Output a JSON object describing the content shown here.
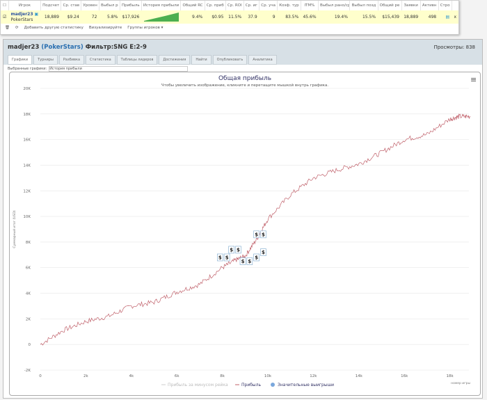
{
  "stats": {
    "headers": [
      "Игрок",
      "Подсчет",
      "Ср. став",
      "Уровен",
      "Выбыл р",
      "Прибыль",
      "История прибыли",
      "Общий RC",
      "Ср. приб",
      "Ср. ROI",
      "Ср. иг",
      "Ср. уча",
      "Коэф. тур",
      "ITM%",
      "Выбыл рано/ср",
      "Выбыл позд",
      "Общий ре",
      "Заявки",
      "Активн",
      "Стро"
    ],
    "row": {
      "player": "madjer23",
      "site": "PokerStars",
      "values": [
        "18,889",
        "$9.24",
        "72",
        "5.8%",
        "$17,926",
        "",
        "9.4%",
        "$0.95",
        "11.5%",
        "37.9",
        "9",
        "83.5%",
        "45.6%",
        "19.4%",
        "15.5%",
        "$15,439",
        "18,889",
        "498"
      ],
      "x": "x"
    },
    "tools": {
      "add": "Добавить другую статистику",
      "viz": "Визуализируйте",
      "groups": "Группы игроков ▾"
    }
  },
  "panel": {
    "player": "madjer23",
    "site": "(PokerStars)",
    "filter": "Фильтр:SNG E:2-9",
    "views": "Просмотры: 838",
    "tabs": [
      "Графики",
      "Турниры",
      "Разбивка",
      "Статистика",
      "Таблицы лидеров",
      "Достижения",
      "Найти",
      "Опубликовать",
      "Аналитика"
    ],
    "selected_label": "Выбранные графики:",
    "selected_value": "История прибыли"
  },
  "chart_data": {
    "type": "line",
    "title": "Общая прибыль",
    "subtitle": "Чтобы увеличить изображение, кликните и перетащите мышкой внутрь графика.",
    "xlabel": "номер игры",
    "ylabel": "Суммарный итог (USD)",
    "xlim": [
      0,
      19000
    ],
    "ylim": [
      -2000,
      20000
    ],
    "xticks": [
      "0",
      "2k",
      "4k",
      "6k",
      "8k",
      "10k",
      "12k",
      "14k",
      "16k",
      "18k"
    ],
    "yticks": [
      "-2K",
      "0",
      "2K",
      "4K",
      "6K",
      "8K",
      "10K",
      "12K",
      "14K",
      "16K",
      "18K",
      "20K"
    ],
    "legend": [
      "Прибыль за минусом рейка",
      "Прибыль",
      "Значительные выигрыши"
    ],
    "series": [
      {
        "name": "Прибыль",
        "color": "#c0606a",
        "x": [
          0,
          1000,
          2000,
          3000,
          4000,
          5000,
          6000,
          7000,
          8000,
          8600,
          9000,
          9500,
          10000,
          11000,
          12000,
          13000,
          14000,
          15000,
          16000,
          17000,
          18000,
          18400,
          18900
        ],
        "y": [
          0,
          1100,
          1800,
          2200,
          3000,
          3300,
          4100,
          4700,
          6000,
          6600,
          6900,
          8200,
          9800,
          11700,
          13000,
          13600,
          14100,
          15000,
          16000,
          16400,
          17600,
          17800,
          17800
        ]
      }
    ],
    "big_wins": {
      "x": [
        7900,
        8200,
        8400,
        8700,
        8900,
        9200,
        9500,
        9800,
        9500,
        9800
      ],
      "y": [
        6800,
        6800,
        7400,
        7400,
        6500,
        6500,
        6800,
        7200,
        8600,
        8600
      ]
    }
  }
}
